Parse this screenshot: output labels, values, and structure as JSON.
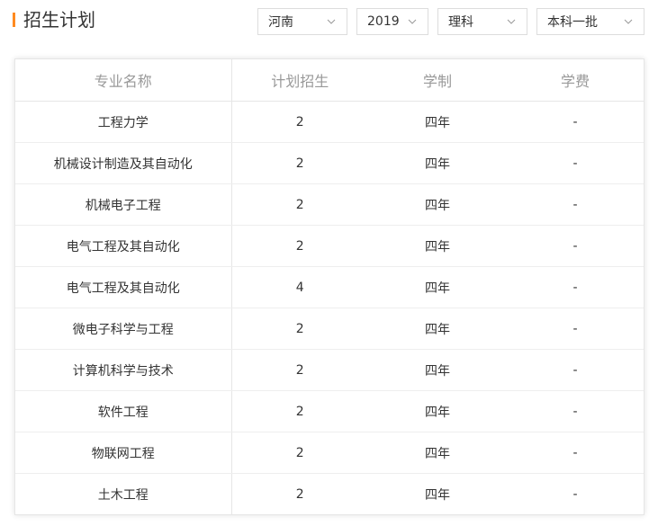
{
  "section": {
    "title": "招生计划"
  },
  "filters": {
    "province": "河南",
    "year": "2019",
    "subject": "理科",
    "batch": "本科一批"
  },
  "colors": {
    "accent": "#ff8a20",
    "border": "#e6e6e6",
    "header_text": "#999999"
  },
  "table": {
    "headers": [
      "专业名称",
      "计划招生",
      "学制",
      "学费"
    ],
    "rows": [
      [
        "工程力学",
        "2",
        "四年",
        "-"
      ],
      [
        "机械设计制造及其自动化",
        "2",
        "四年",
        "-"
      ],
      [
        "机械电子工程",
        "2",
        "四年",
        "-"
      ],
      [
        "电气工程及其自动化",
        "2",
        "四年",
        "-"
      ],
      [
        "电气工程及其自动化",
        "4",
        "四年",
        "-"
      ],
      [
        "微电子科学与工程",
        "2",
        "四年",
        "-"
      ],
      [
        "计算机科学与技术",
        "2",
        "四年",
        "-"
      ],
      [
        "软件工程",
        "2",
        "四年",
        "-"
      ],
      [
        "物联网工程",
        "2",
        "四年",
        "-"
      ],
      [
        "土木工程",
        "2",
        "四年",
        "-"
      ]
    ]
  },
  "icons": {
    "filter_chevron": "chevron-down-icon"
  }
}
